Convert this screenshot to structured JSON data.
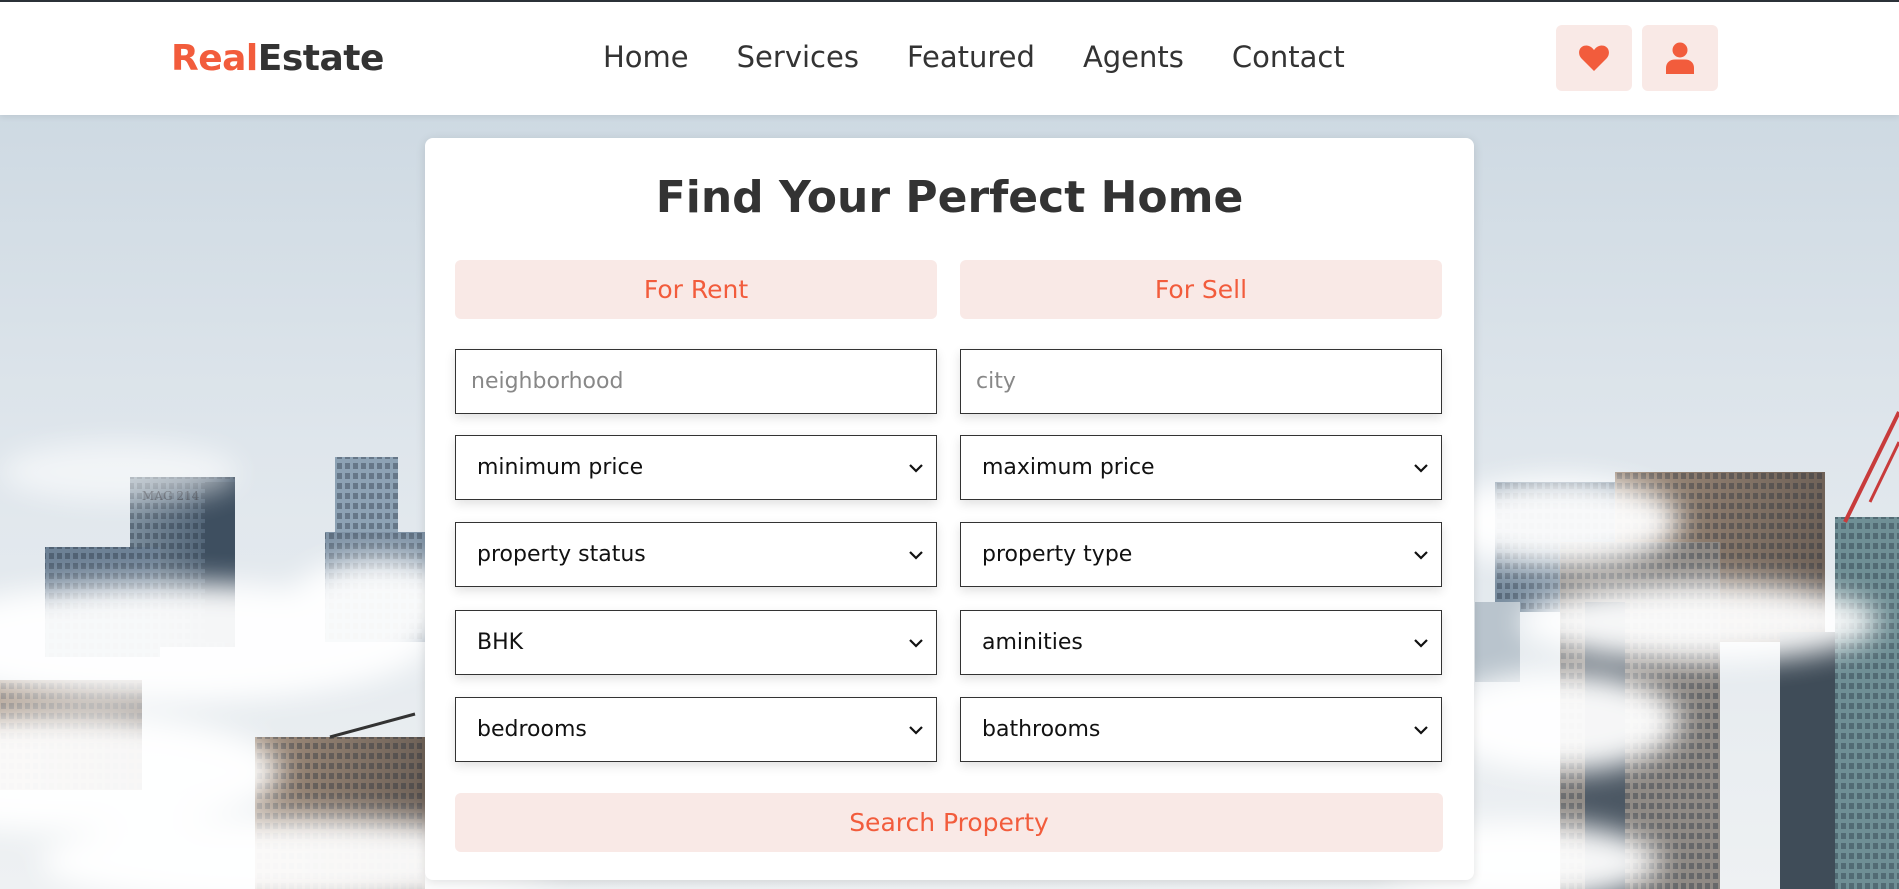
{
  "brand": {
    "logo_part1": "Real",
    "logo_part2": "Estate",
    "accent_color": "#f25c3c",
    "tint_color": "#f9e9e6"
  },
  "nav": {
    "items": [
      "Home",
      "Services",
      "Featured",
      "Agents",
      "Contact"
    ]
  },
  "header_actions": {
    "favorites_icon": "heart-icon",
    "account_icon": "user-icon"
  },
  "search_form": {
    "title": "Find Your Perfect Home",
    "tabs": [
      "For Rent",
      "For Sell"
    ],
    "inputs": {
      "neighborhood_placeholder": "neighborhood",
      "city_placeholder": "city"
    },
    "selects": {
      "min_price": "minimum price",
      "max_price": "maximum price",
      "property_status": "property status",
      "property_type": "property type",
      "bhk": "BHK",
      "amenities": "aminities",
      "bedrooms": "bedrooms",
      "bathrooms": "bathrooms"
    },
    "submit_label": "Search Property"
  },
  "background": {
    "sign_text": "MAG 214"
  }
}
